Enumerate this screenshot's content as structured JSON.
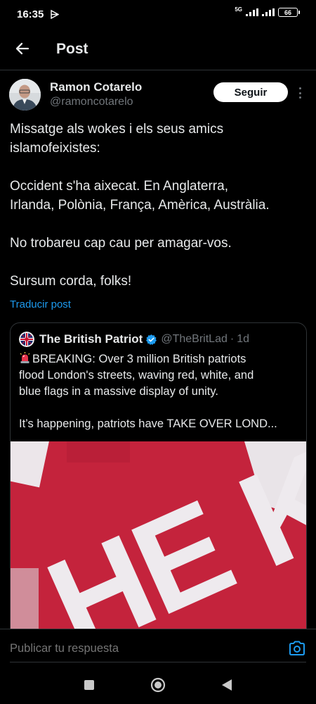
{
  "status_bar": {
    "time": "16:35",
    "network": "5G",
    "battery": "66"
  },
  "header": {
    "title": "Post"
  },
  "post": {
    "author_name": "Ramon Cotarelo",
    "author_handle": "@ramoncotarelo",
    "follow_label": "Seguir",
    "paragraphs": [
      [
        "Missatge als wokes i els seus amics",
        "islamofeixistes:"
      ],
      [
        "Occident s'ha aixecat. En Anglaterra,",
        "Irlanda, Polònia, França, Amèrica, Austràlia."
      ],
      [
        "No trobareu cap cau per amagar-vos."
      ],
      [
        "Sursum corda, folks!"
      ]
    ],
    "translate_label": "Traducir post"
  },
  "quote": {
    "name": "The British Patriot",
    "handle": "@TheBritLad",
    "time_sep": "·",
    "time": "1d",
    "lines1": [
      "BREAKING: Over 3 million British patriots",
      "flood London's streets, waving red, white, and",
      "blue flags in a massive display of unity."
    ],
    "lines2": [
      "It’s happening, patriots have TAKE OVER LOND..."
    ],
    "media_text": "HE K"
  },
  "reply": {
    "placeholder": "Publicar tu respuesta"
  },
  "colors": {
    "accent": "#1d9bf0",
    "background": "#000000",
    "flag_red": "#c4233c"
  },
  "icons": [
    "back-arrow-icon",
    "more-icon",
    "verified-icon",
    "siren-icon",
    "camera-icon",
    "recents-icon",
    "home-icon",
    "back-triangle-icon"
  ]
}
